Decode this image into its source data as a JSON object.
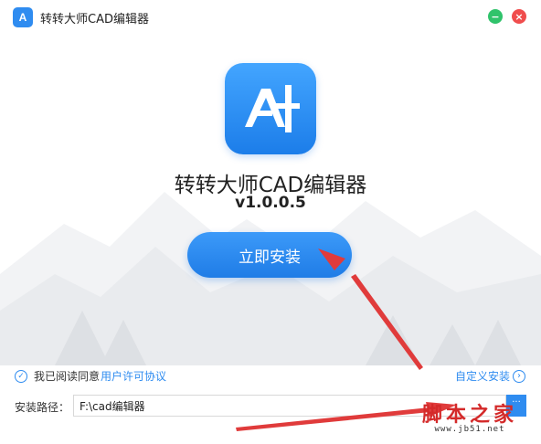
{
  "window": {
    "title": "转转大师CAD编辑器",
    "icon_text": "A",
    "minimize_glyph": "−",
    "close_glyph": "×"
  },
  "main": {
    "app_name": "转转大师CAD编辑器",
    "version": "v1.0.0.5",
    "install_button": "立即安装"
  },
  "footer": {
    "agree_text": "我已阅读同意",
    "license_link": "用户许可协议",
    "custom_install": "自定义安装",
    "path_label": "安装路径：",
    "path_value": "F:\\cad编辑器",
    "browse_glyph": "..."
  },
  "watermark": {
    "main": "脚本之家",
    "sub": "www.jb51.net"
  },
  "colors": {
    "accent": "#2f8cf0",
    "minimize": "#30c36b",
    "close": "#f04d4d",
    "arrow": "#e03b3b"
  },
  "icons": [
    "app-logo-icon",
    "check-circle-icon",
    "chevron-right-icon",
    "minimize-icon",
    "close-icon"
  ]
}
